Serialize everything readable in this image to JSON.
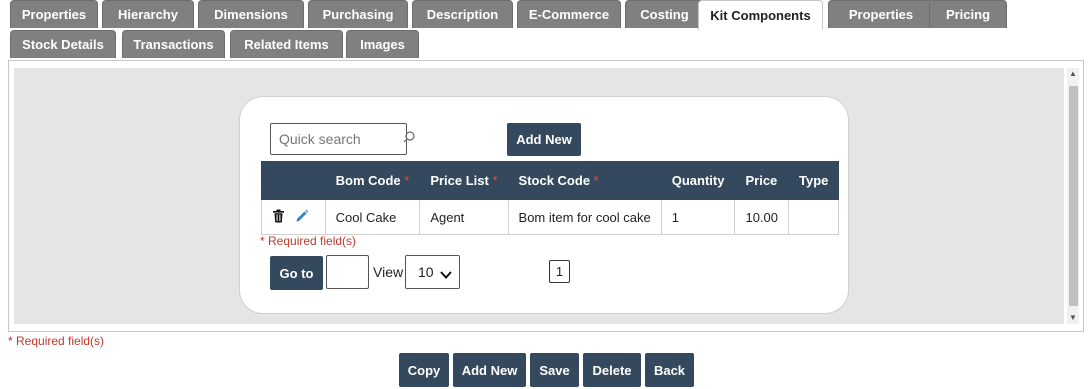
{
  "tabs_row1": [
    {
      "label": "Properties",
      "active": false
    },
    {
      "label": "Hierarchy",
      "active": false
    },
    {
      "label": "Dimensions",
      "active": false
    },
    {
      "label": "Purchasing",
      "active": false
    },
    {
      "label": "Description",
      "active": false
    },
    {
      "label": "E-Commerce",
      "active": false
    },
    {
      "label": "Costing",
      "active": false
    },
    {
      "label": "Kit Components",
      "active": true
    },
    {
      "label": "Properties",
      "active": false
    },
    {
      "label": "Pricing",
      "active": false
    }
  ],
  "tabs_row2": [
    {
      "label": "Stock Details",
      "active": false
    },
    {
      "label": "Transactions",
      "active": false
    },
    {
      "label": "Related Items",
      "active": false
    },
    {
      "label": "Images",
      "active": false
    }
  ],
  "search": {
    "placeholder": "Quick search",
    "value": ""
  },
  "card_add_new": "Add New",
  "table": {
    "columns": [
      {
        "label": "Bom Code",
        "required": "*"
      },
      {
        "label": "Price List",
        "required": "*"
      },
      {
        "label": "Stock Code",
        "required": "*"
      },
      {
        "label": "Quantity",
        "required": ""
      },
      {
        "label": "Price",
        "required": ""
      },
      {
        "label": "Type",
        "required": ""
      }
    ],
    "rows": [
      {
        "bom_code": "Cool Cake",
        "price_list": "Agent",
        "stock_code": "Bom item for cool cake",
        "quantity": "1",
        "price": "10.00",
        "type": ""
      }
    ]
  },
  "required_note": "* Required field(s)",
  "pagination": {
    "goto_label": "Go to",
    "goto_value": "",
    "view_label": "View",
    "view_value": "10",
    "page": "1"
  },
  "page_required_note": "* Required field(s)",
  "actions": {
    "copy": "Copy",
    "add_new": "Add New",
    "save": "Save",
    "delete": "Delete",
    "back": "Back"
  },
  "colors": {
    "tab_bg": "#808080",
    "header_bg": "#34495e",
    "button_bg": "#34495e",
    "required": "#e74c3c",
    "panel_bg": "#e5e5e5"
  },
  "icons": {
    "search": "search-icon",
    "delete": "trash-icon",
    "edit": "pencil-icon",
    "dropdown": "chevron-down-icon"
  }
}
